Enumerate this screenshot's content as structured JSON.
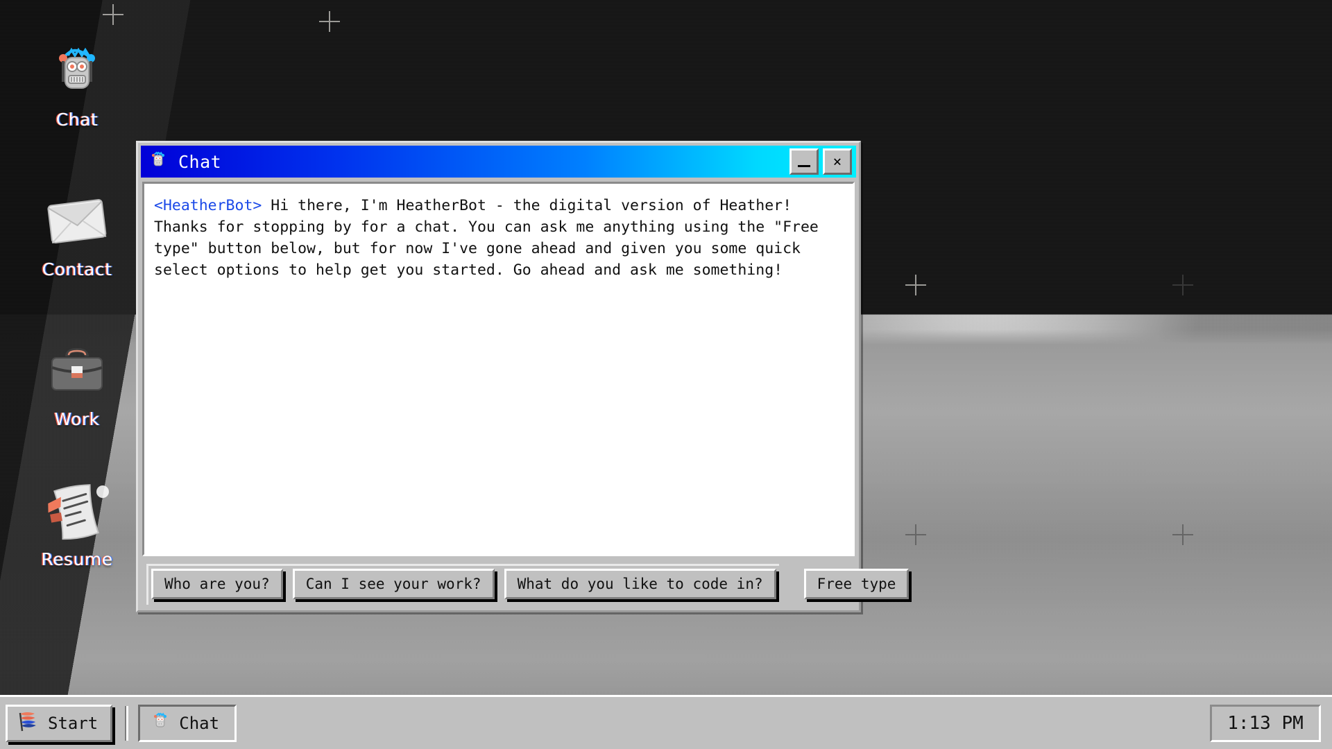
{
  "desktop": {
    "icons": [
      {
        "id": "chat",
        "label": "Chat",
        "icon": "robot-icon"
      },
      {
        "id": "contact",
        "label": "Contact",
        "icon": "envelope-icon"
      },
      {
        "id": "work",
        "label": "Work",
        "icon": "briefcase-icon"
      },
      {
        "id": "resume",
        "label": "Resume",
        "icon": "scroll-document-icon"
      }
    ]
  },
  "window": {
    "title": "Chat",
    "title_icon": "robot-icon",
    "minimize_label": "_",
    "close_label": "×",
    "titlebar_gradient_from": "#0000d8",
    "titlebar_gradient_to": "#00f0ff"
  },
  "chat": {
    "messages": [
      {
        "speaker": "<HeatherBot>",
        "speaker_color": "#1b49e8",
        "text": " Hi there, I'm HeatherBot - the digital version of Heather! Thanks for stopping by for a chat. You can ask me anything using the \"Free type\" button below, but for now I've gone ahead and given you some quick select options to help get you started. Go ahead and ask me something!"
      }
    ]
  },
  "quick_replies": [
    {
      "id": "who-are-you",
      "label": "Who are you?"
    },
    {
      "id": "see-work",
      "label": "Can I see your work?"
    },
    {
      "id": "code-in",
      "label": "What do you like to code in?"
    }
  ],
  "free_type": {
    "label": "Free type"
  },
  "taskbar": {
    "start": {
      "label": "Start",
      "icon": "flag-icon"
    },
    "tasks": [
      {
        "id": "chat",
        "label": "Chat",
        "icon": "robot-icon",
        "active": true
      }
    ],
    "clock": "1:13 PM"
  }
}
